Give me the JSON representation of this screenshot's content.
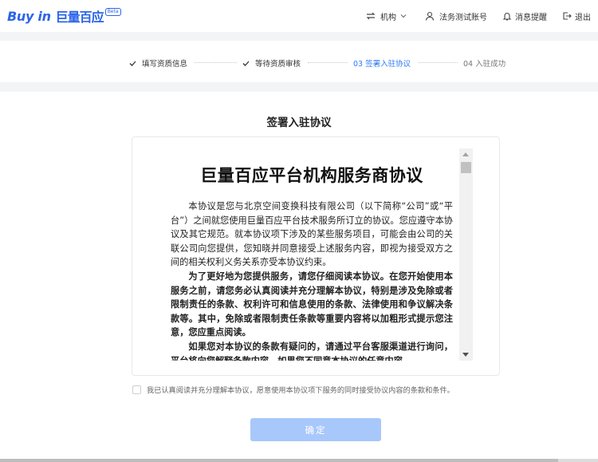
{
  "header": {
    "logo_en": "Buy in",
    "logo_cn": "巨量百应",
    "logo_badge": "Beta",
    "institution_label": "机构",
    "account_label": "法务测试账号",
    "messages_label": "消息提醒",
    "logout_label": "退出"
  },
  "steps": [
    {
      "label": "填写资质信息",
      "state": "done"
    },
    {
      "label": "等待资质审核",
      "state": "done"
    },
    {
      "label": "03 签署入驻协议",
      "state": "active"
    },
    {
      "label": "04 入驻成功",
      "state": "pending"
    }
  ],
  "main": {
    "title": "签署入驻协议",
    "agreement": {
      "title": "巨量百应平台机构服务商协议",
      "paragraphs": [
        "本协议是您与北京空间变换科技有限公司（以下简称“公司”或“平台”）之间就您使用巨量百应平台技术服务所订立的协议。您应遵守本协议及其它规范。就本协议项下涉及的某些服务项目，可能会由公司的关联公司向您提供，您知晓并同意接受上述服务内容，即视为接受双方之间的相关权利义务关系亦受本协议约束。",
        "为了更好地为您提供服务，请您仔细阅读本协议。在您开始使用本服务之前，请您务必认真阅读并充分理解本协议，特别是涉及免除或者限制责任的条款、权利许可和信息使用的条款、法律使用和争议解决条款等。其中，免除或者限制责任条款等重要内容将以加粗形式提示您注意，您应重点阅读。",
        "如果您对本协议的条款有疑问的，请通过平台客服渠道进行询问，平台将向您解释条款内容。如果您不同意本协议的任意内容，"
      ]
    },
    "consent_text": "我已认真阅读并充分理解本协议，愿意使用本协议项下服务的同时接受协议内容的条款和条件。",
    "consent_checked": false,
    "confirm_label": "确定"
  },
  "colors": {
    "brand": "#2b64e8",
    "active_step": "#2e7bf6",
    "button_disabled": "#a8c8fb"
  }
}
